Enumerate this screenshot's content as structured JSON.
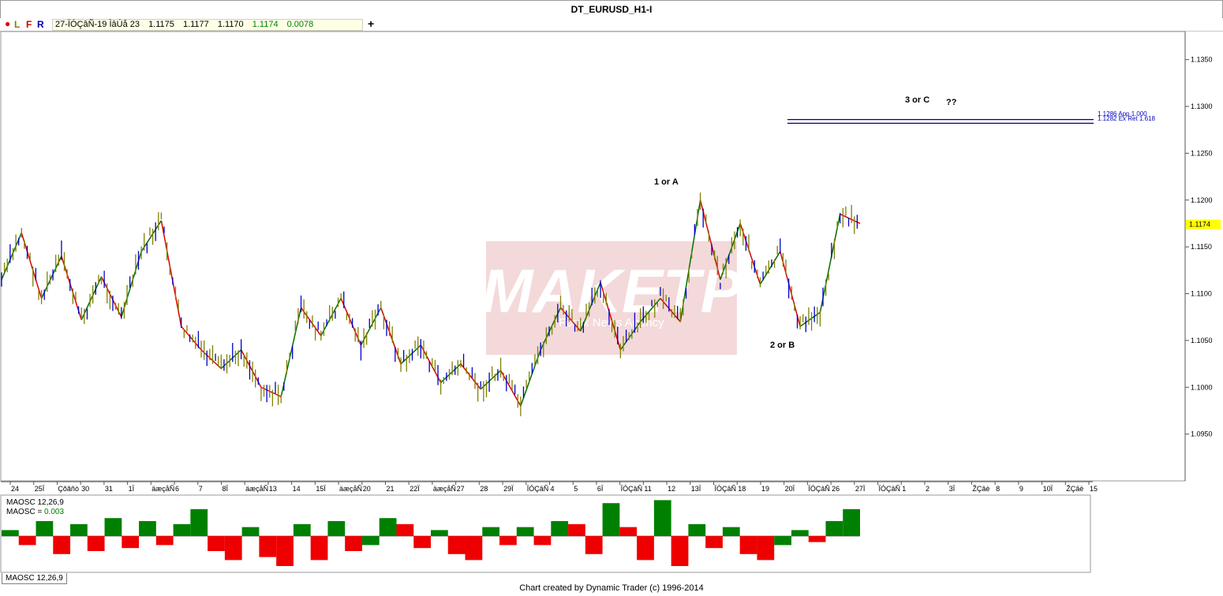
{
  "window": {
    "title": "DT_EURUSD_H1-I"
  },
  "toolbar": {
    "dot_color": "#dd0000",
    "letters": [
      "L",
      "F",
      "R"
    ],
    "quote": {
      "date": "27-ÏÓÇâÑ-19 ÌâÚå 23",
      "open": "1.1175",
      "high": "1.1177",
      "low": "1.1170",
      "close": "1.1174",
      "change": "0.0078"
    },
    "plus_icon": "+"
  },
  "annotations": {
    "wave1": "1 or A",
    "wave2": "2 or B",
    "wave3": "3 or C",
    "question": "??",
    "target1": "1.1286 App 1.000",
    "target2": "1.1282 Ex Ret 1.618"
  },
  "watermark": {
    "main": "MAKETP",
    "sub": "Forex News Agency"
  },
  "price_label": "1.1174",
  "indicator": {
    "name": "MAOSC 12,26,9",
    "value_label": "MAOSC =",
    "value": "0.003",
    "tab_label": "MAOSC 12,26,9"
  },
  "footer": "Chart created by Dynamic Trader  (c) 1996-2014",
  "chart_data": {
    "type": "line",
    "title": "DT_EURUSD_H1-I",
    "ylim": [
      1.09,
      1.138
    ],
    "y_ticks": [
      "1.1350",
      "1.1300",
      "1.1250",
      "1.1200",
      "1.1150",
      "1.1100",
      "1.1050",
      "1.1000",
      "1.0950"
    ],
    "x_ticks": [
      "24",
      "25Ï",
      "Çõãñò",
      "30",
      "31",
      "1Ï",
      "äæçåÑ",
      "6",
      "7",
      "8Ï",
      "äæçåÑ",
      "13",
      "14",
      "15Ï",
      "äæçåÑ",
      "20",
      "21",
      "22Ï",
      "äæçåÑ",
      "27",
      "28",
      "29Ï",
      "ÏÓÇâÑ",
      "4",
      "5",
      "6Ï",
      "ÏÓÇâÑ",
      "11",
      "12",
      "13Ï",
      "ÏÓÇâÑ",
      "18",
      "19",
      "20Ï",
      "ÏÓÇâÑ",
      "26",
      "27Ï",
      "ÏÓÇâÑ",
      "1",
      "2",
      "3Ï",
      "ŽÇâè",
      "8",
      "9",
      "10Ï",
      "ŽÇâè",
      "15"
    ],
    "swing_points": [
      1.1115,
      1.1165,
      1.1095,
      1.114,
      1.1072,
      1.1118,
      1.1075,
      1.1145,
      1.1178,
      1.1065,
      1.104,
      1.102,
      1.104,
      1.1,
      1.099,
      1.1085,
      1.1055,
      1.1095,
      1.1045,
      1.1085,
      1.1025,
      1.1045,
      1.1005,
      1.1025,
      1.0998,
      1.1018,
      1.098,
      1.104,
      1.1085,
      1.106,
      1.1112,
      1.104,
      1.107,
      1.1095,
      1.107,
      1.12,
      1.1115,
      1.1175,
      1.111,
      1.1145,
      1.1065,
      1.108,
      1.1185,
      1.1175
    ],
    "targets": [
      1.1286,
      1.1282
    ],
    "last_price": 1.1174,
    "oscillator": {
      "name": "MAOSC 12,26,9",
      "values": [
        0.2,
        -0.3,
        0.5,
        -0.6,
        0.4,
        -0.5,
        0.6,
        -0.4,
        0.5,
        -0.3,
        0.4,
        0.9,
        -0.5,
        -0.8,
        0.3,
        -0.7,
        -1.0,
        0.4,
        -0.8,
        0.5,
        -0.5,
        -0.3,
        0.6,
        0.4,
        -0.4,
        0.2,
        -0.6,
        -0.8,
        0.3,
        -0.3,
        0.3,
        -0.3,
        0.5,
        0.4,
        -0.6,
        1.1,
        0.3,
        -0.8,
        1.2,
        -1.0,
        0.4,
        -0.4,
        0.3,
        -0.6,
        -0.8,
        -0.3,
        0.2,
        -0.2,
        0.5,
        0.9
      ]
    }
  }
}
